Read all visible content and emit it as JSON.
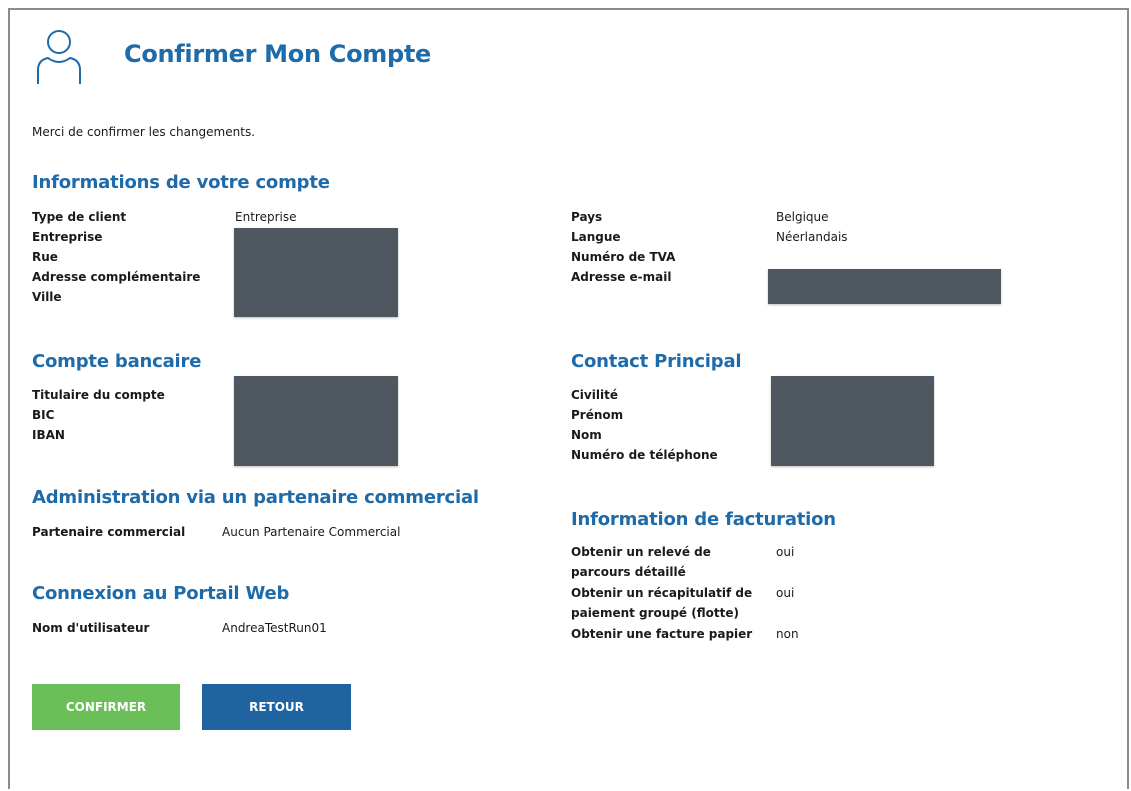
{
  "header": {
    "title": "Confirmer Mon Compte",
    "icon": "user-icon"
  },
  "intro": "Merci de confirmer les changements.",
  "account_info": {
    "heading": "Informations de votre compte",
    "left_labels": [
      "Type de client",
      "Entreprise",
      "Rue",
      "Adresse complémentaire",
      "Ville"
    ],
    "client_type_value": "Entreprise",
    "right_labels": [
      "Pays",
      "Langue",
      "Numéro de TVA",
      "Adresse e-mail"
    ],
    "country_value": "Belgique",
    "language_value": "Néerlandais"
  },
  "bank": {
    "heading": "Compte bancaire",
    "labels": [
      "Titulaire du compte",
      "BIC",
      "IBAN"
    ]
  },
  "contact": {
    "heading": "Contact Principal",
    "labels": [
      "Civilité",
      "Prénom",
      "Nom",
      "Numéro de téléphone"
    ]
  },
  "admin": {
    "heading": "Administration via un partenaire commercial",
    "label": "Partenaire commercial",
    "value": "Aucun Partenaire Commercial"
  },
  "portal": {
    "heading": "Connexion au Portail Web",
    "label": "Nom d'utilisateur",
    "value": "AndreaTestRun01"
  },
  "billing": {
    "heading": "Information de facturation",
    "rows": [
      {
        "label": "Obtenir un relevé de parcours détaillé",
        "value": "oui"
      },
      {
        "label": "Obtenir un récapitulatif de paiement groupé (flotte)",
        "value": "oui"
      },
      {
        "label": "Obtenir une facture papier",
        "value": "non"
      }
    ]
  },
  "buttons": {
    "confirm": "CONFIRMER",
    "back": "RETOUR"
  },
  "colors": {
    "accent": "#1f6aa8",
    "confirm": "#6bbf59",
    "back": "#1f64a0",
    "redaction": "#4f5761"
  }
}
